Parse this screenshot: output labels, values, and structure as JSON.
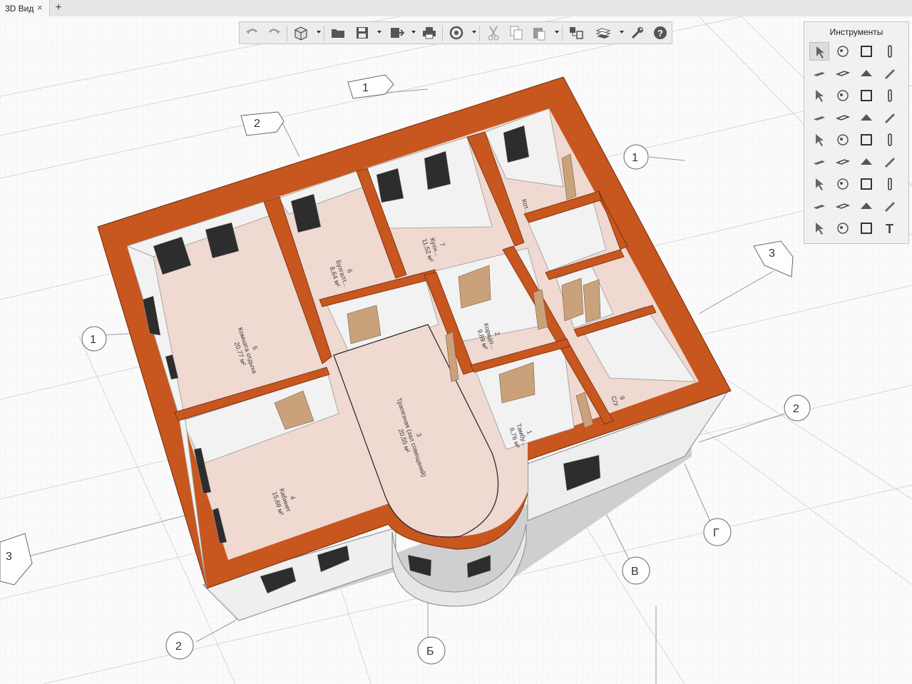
{
  "tab": {
    "label": "3D Вид",
    "close_glyph": "×",
    "add_glyph": "+"
  },
  "toolbar": {
    "buttons": [
      "undo-icon",
      "redo-icon",
      "view-3d-icon",
      "open-folder-icon",
      "save-icon",
      "export-icon",
      "print-icon",
      "orbit-icon",
      "cut-icon",
      "copy-icon",
      "paste-icon",
      "layers-icon",
      "levels-icon",
      "wrench-icon",
      "help-icon"
    ]
  },
  "tools_panel": {
    "title": "Инструменты",
    "rows": [
      [
        "select-arrow-icon",
        "materials-icon",
        "room-icon",
        "column-icon"
      ],
      [
        "wall-icon",
        "slab-icon",
        "roof-icon",
        "beam-icon"
      ],
      [
        "stairs-icon",
        "ramp-icon",
        "door-icon",
        "window-icon"
      ],
      [
        "railing-icon",
        "line-icon",
        "fixture-icon",
        "pipe-icon"
      ],
      [
        "plumbing-icon",
        "appliance-icon",
        "furniture-icon",
        "fitting-icon"
      ],
      [
        "heating-icon",
        "socket-icon",
        "cable-icon",
        "device-icon"
      ],
      [
        "equipment-icon",
        "lamp-icon",
        "electrical-icon",
        "camera-icon"
      ],
      [
        "boiler-icon",
        "object-icon",
        "panel-icon",
        "connector-icon"
      ],
      [
        "dimension-icon",
        "polyline-icon",
        "hatch-icon",
        "text-icon"
      ]
    ]
  },
  "model": {
    "colors": {
      "wall_cut": "#c8561f",
      "floor": "#efd9d1",
      "wall_face": "#f2f2f2",
      "door": "#c9a27c"
    },
    "rooms": [
      {
        "num": "5",
        "name": "Комната отдыха",
        "area": "20,77 м²"
      },
      {
        "num": "6",
        "name": "Бухгалт...",
        "area": "8,64 м²"
      },
      {
        "num": "7",
        "name": "Кухн...",
        "area": "11,52 м²"
      },
      {
        "num": "2",
        "name": "Коридо...",
        "area": "9,89 м²"
      },
      {
        "num": "3",
        "name": "Трапезная (зал совещаний)",
        "area": "20,55 м²"
      },
      {
        "num": "4",
        "name": "Кабинет",
        "area": "15,68 м²"
      },
      {
        "num": "1",
        "name": "Тамбу...",
        "area": "6,76 м²"
      },
      {
        "num": "9",
        "name": "С/У",
        "area": ""
      },
      {
        "num": "",
        "name": "Кот...",
        "area": ""
      }
    ],
    "axes": [
      "1",
      "2",
      "3",
      "1",
      "2",
      "3",
      "1",
      "2",
      "Б",
      "В",
      "Г"
    ]
  }
}
